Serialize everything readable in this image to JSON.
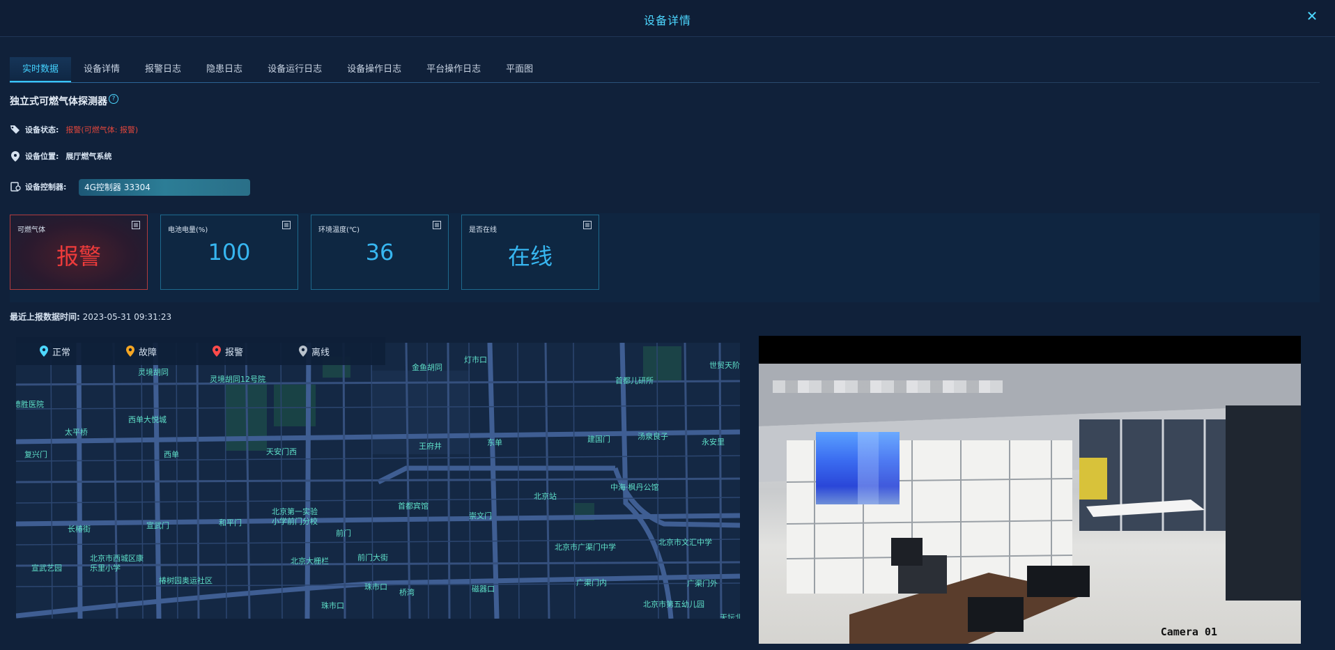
{
  "dialog": {
    "title": "设备详情"
  },
  "tabs": [
    {
      "label": "实时数据",
      "active": true
    },
    {
      "label": "设备详情"
    },
    {
      "label": "报警日志"
    },
    {
      "label": "隐患日志"
    },
    {
      "label": "设备运行日志"
    },
    {
      "label": "设备操作日志"
    },
    {
      "label": "平台操作日志"
    },
    {
      "label": "平面图"
    }
  ],
  "device": {
    "name": "独立式可燃气体探测器",
    "help_icon": "?",
    "status_label": "设备状态:",
    "status_value": "报警(可燃气体: 报警)",
    "location_label": "设备位置:",
    "location_value": "展厅燃气系统",
    "controller_label": "设备控制器:",
    "controller_value": "4G控制器 33304"
  },
  "metrics": [
    {
      "label": "可燃气体",
      "value": "报警",
      "state": "alarm"
    },
    {
      "label": "电池电量(%)",
      "value": "100"
    },
    {
      "label": "环境温度(℃)",
      "value": "36"
    },
    {
      "label": "是否在线",
      "value": "在线"
    }
  ],
  "report": {
    "label": "最近上报数据时间:",
    "time": "2023-05-31 09:31:23"
  },
  "legend": [
    {
      "label": "正常",
      "color": "#4dd7ff"
    },
    {
      "label": "故障",
      "color": "#f5a623"
    },
    {
      "label": "报警",
      "color": "#ff4b4b"
    },
    {
      "label": "离线",
      "color": "#b9c2cc"
    }
  ],
  "map_labels": [
    "灵境胡同",
    "灵境胡同12号院",
    "金鱼胡同",
    "灯市口",
    "首都儿研所",
    "世贸天阶",
    "德胜医院",
    "西单大悦城",
    "太平桥",
    "复兴门",
    "西单",
    "天安门西",
    "王府井",
    "东单",
    "建国门",
    "汤泉良子",
    "永安里",
    "北京站",
    "中海·枫丹公馆",
    "首都宾馆",
    "崇文门",
    "长椿街",
    "宣武门",
    "和平门",
    "北京第一实验小学前门分校",
    "前门",
    "北京市广渠门中学",
    "北京市文汇中学",
    "宣武艺园",
    "北京市西城区康乐里小学",
    "北京大栅栏",
    "前门大街",
    "广渠门内",
    "广渠门外",
    "椿树园奥运社区",
    "珠市口",
    "桥湾",
    "磁器口",
    "珠市口",
    "北京市第五幼儿园",
    "天坛北里"
  ],
  "camera": {
    "caption": "Camera 01"
  }
}
